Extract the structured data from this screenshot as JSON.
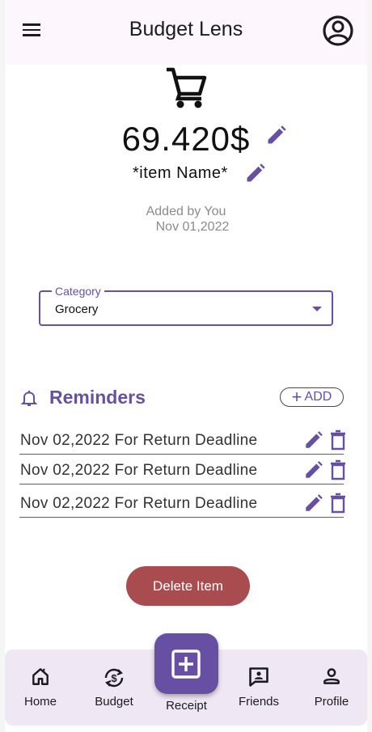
{
  "app_bar": {
    "title": "Budget Lens"
  },
  "item": {
    "price": "69.420$",
    "name": "*item Name*",
    "added_by": "Added by You",
    "added_date": "Nov 01,2022"
  },
  "category": {
    "label": "Category",
    "value": "Grocery"
  },
  "reminders": {
    "title": "Reminders",
    "add_label": "ADD",
    "items": [
      {
        "text": "Nov 02,2022 For Return Deadline"
      },
      {
        "text": "Nov 02,2022 For Return Deadline"
      },
      {
        "text": "Nov 02,2022 For Return Deadline"
      }
    ]
  },
  "delete_button": "Delete Item",
  "bottom_nav": {
    "items": [
      {
        "label": "Home",
        "icon": "home-icon"
      },
      {
        "label": "Budget",
        "icon": "budget-icon"
      },
      {
        "label": "Receipt",
        "icon": "add-receipt-icon"
      },
      {
        "label": "Friends",
        "icon": "friends-icon"
      },
      {
        "label": "Profile",
        "icon": "profile-icon"
      }
    ]
  },
  "colors": {
    "accent": "#6750a4",
    "delete": "#a94c4f",
    "app_bar_bg": "#fdf7fd",
    "nav_bg": "#efe7f4"
  }
}
